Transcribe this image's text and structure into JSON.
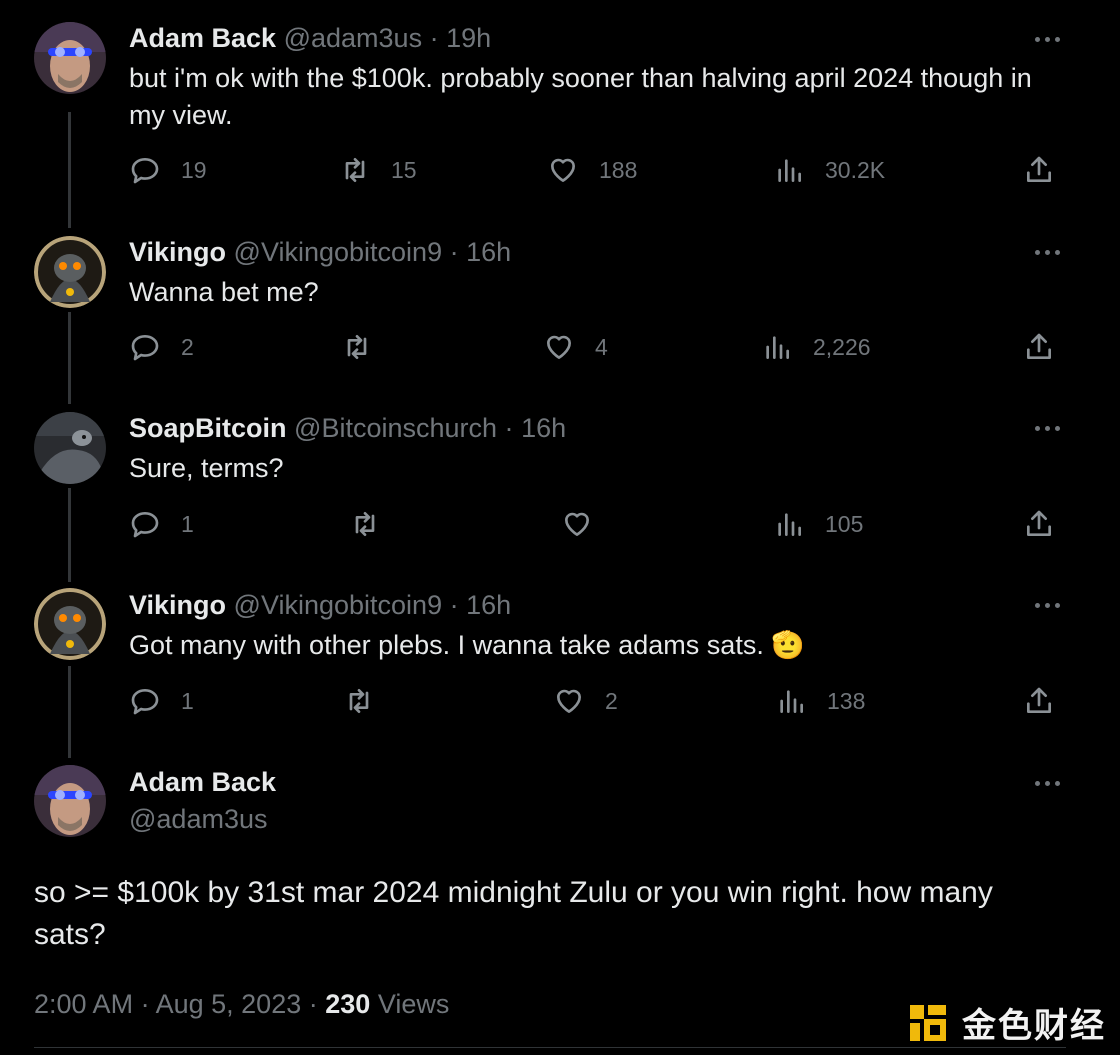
{
  "replies": [
    {
      "name": "Adam Back",
      "handle": "@adam3us",
      "time": "19h",
      "text": "but i'm ok with the $100k. probably sooner than halving april 2024 though in my view.",
      "replies": "19",
      "reposts": "15",
      "likes": "188",
      "views": "30.2K"
    },
    {
      "name": "Vikingo",
      "handle": "@Vikingobitcoin9",
      "time": "16h",
      "text": "Wanna bet me?",
      "replies": "2",
      "reposts": "",
      "likes": "4",
      "views": "2,226"
    },
    {
      "name": "SoapBitcoin",
      "handle": "@Bitcoinschurch",
      "time": "16h",
      "text": "Sure, terms?",
      "replies": "1",
      "reposts": "",
      "likes": "",
      "views": "105"
    },
    {
      "name": "Vikingo",
      "handle": "@Vikingobitcoin9",
      "time": "16h",
      "text": "Got many with other plebs. I wanna take adams sats. 🫡",
      "replies": "1",
      "reposts": "",
      "likes": "2",
      "views": "138"
    }
  ],
  "main": {
    "name": "Adam Back",
    "handle": "@adam3us",
    "text": "so >= $100k by 31st mar 2024 midnight Zulu or you win right. how many sats?",
    "time": "2:00 AM",
    "date": "Aug 5, 2023",
    "views_count": "230",
    "views_label": "Views"
  },
  "separator": "·",
  "watermark": "金色财经",
  "icons": {
    "reply": "reply-icon",
    "repost": "repost-icon",
    "like": "heart-icon",
    "views": "views-icon",
    "share": "share-icon",
    "more": "more-icon"
  },
  "colors": {
    "background": "#000000",
    "text": "#e7e9ea",
    "muted": "#71767b",
    "thread_line": "#333639",
    "watermark_accent": "#f0b90b"
  }
}
